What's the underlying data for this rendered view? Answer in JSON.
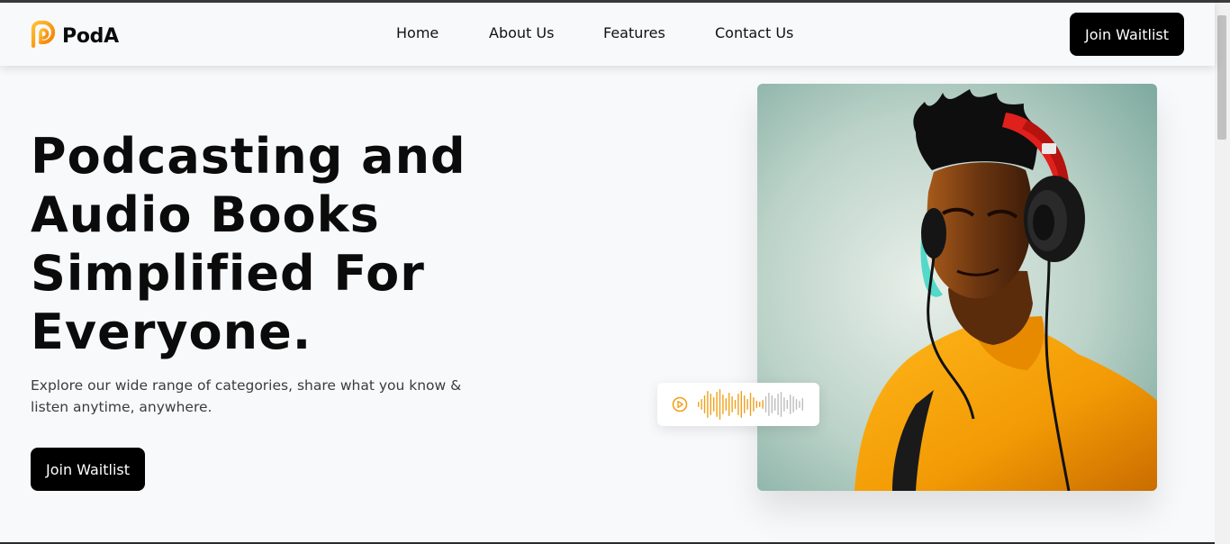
{
  "brand": {
    "name": "PodA",
    "logo_icon": "podcast-logo-icon",
    "accent_color": "#f59e0b"
  },
  "nav": {
    "links": [
      {
        "label": "Home"
      },
      {
        "label": "About Us"
      },
      {
        "label": "Features"
      },
      {
        "label": "Contact Us"
      }
    ],
    "cta_label": "Join Waitlist"
  },
  "hero": {
    "title_lines": [
      "Podcasting and",
      "Audio Books",
      "Simplified For",
      "Everyone."
    ],
    "subtitle": "Explore our wide range of categories, share what you know & listen anytime, anywhere.",
    "cta_label": "Join Waitlist",
    "image_icon": "person-with-headphones-image",
    "audio_player": {
      "play_icon": "play-circle-icon",
      "waveform_icon": "audio-waveform-icon",
      "played_color": "#f0a01a",
      "unplayed_color": "#bdbdbd"
    }
  }
}
